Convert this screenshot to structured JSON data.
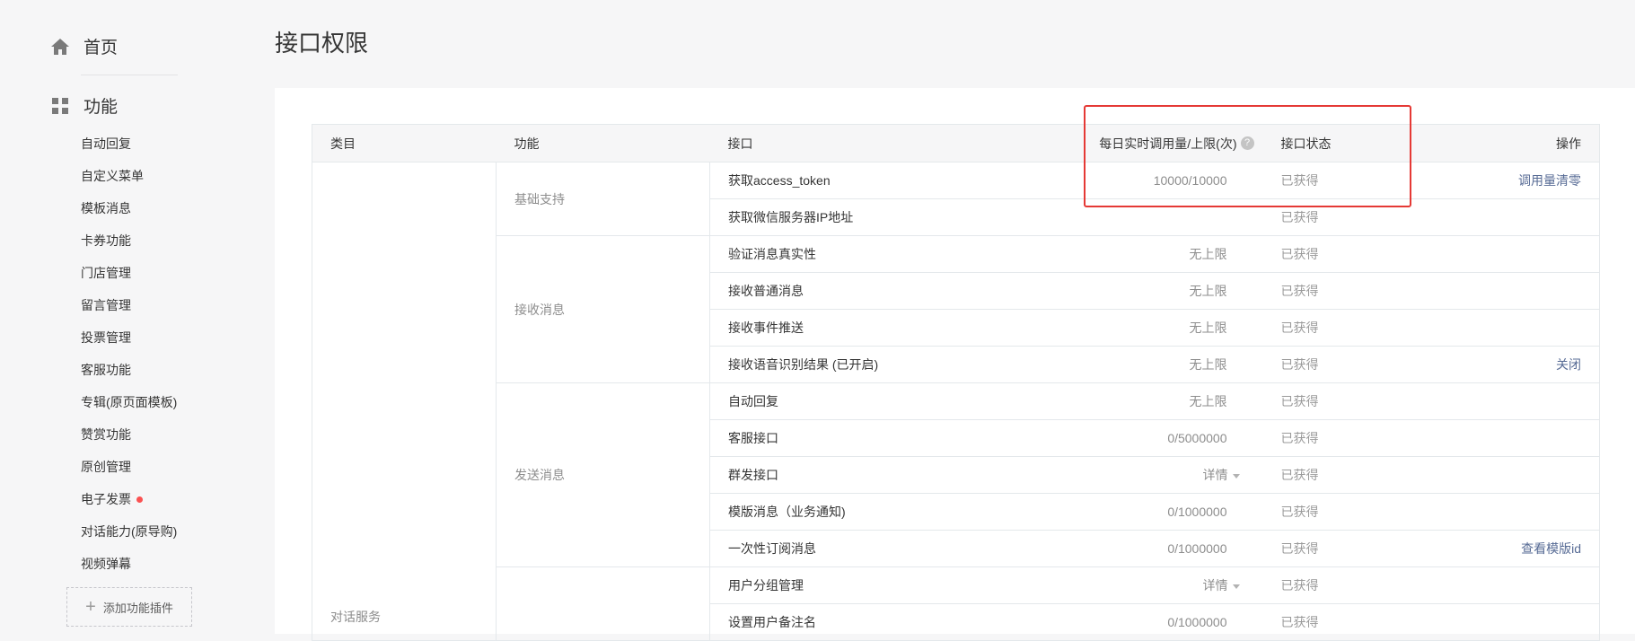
{
  "sidebar": {
    "home": {
      "label": "首页",
      "icon": "home-icon"
    },
    "features": {
      "label": "功能",
      "icon": "grid-icon"
    },
    "items": [
      {
        "label": "自动回复"
      },
      {
        "label": "自定义菜单"
      },
      {
        "label": "模板消息"
      },
      {
        "label": "卡券功能"
      },
      {
        "label": "门店管理"
      },
      {
        "label": "留言管理"
      },
      {
        "label": "投票管理"
      },
      {
        "label": "客服功能"
      },
      {
        "label": "专辑(原页面模板)"
      },
      {
        "label": "赞赏功能"
      },
      {
        "label": "原创管理"
      },
      {
        "label": "电子发票",
        "badge": "red-dot"
      },
      {
        "label": "对话能力(原导购)"
      },
      {
        "label": "视频弹幕"
      }
    ],
    "add_plugin_label": "添加功能插件"
  },
  "page": {
    "title": "接口权限"
  },
  "table": {
    "headers": {
      "category": "类目",
      "function": "功能",
      "api": "接口",
      "quota": "每日实时调用量/上限(次)",
      "help": "?",
      "status": "接口状态",
      "operation": "操作"
    },
    "category": "对话服务",
    "groups": {
      "basic": "基础支持",
      "receive": "接收消息",
      "send": "发送消息"
    },
    "rows": [
      {
        "api": "获取access_token",
        "quota": "10000/10000",
        "status": "已获得",
        "op": "调用量清零"
      },
      {
        "api": "获取微信服务器IP地址",
        "quota": "",
        "status": "已获得",
        "op": ""
      },
      {
        "api": "验证消息真实性",
        "quota": "无上限",
        "status": "已获得",
        "op": ""
      },
      {
        "api": "接收普通消息",
        "quota": "无上限",
        "status": "已获得",
        "op": ""
      },
      {
        "api": "接收事件推送",
        "quota": "无上限",
        "status": "已获得",
        "op": ""
      },
      {
        "api": "接收语音识别结果 (已开启)",
        "quota": "无上限",
        "status": "已获得",
        "op": "关闭"
      },
      {
        "api": "自动回复",
        "quota": "无上限",
        "status": "已获得",
        "op": ""
      },
      {
        "api": "客服接口",
        "quota": "0/5000000",
        "status": "已获得",
        "op": ""
      },
      {
        "api": "群发接口",
        "quota": "详情",
        "status": "已获得",
        "op": ""
      },
      {
        "api": "模版消息（业务通知)",
        "quota": "0/1000000",
        "status": "已获得",
        "op": ""
      },
      {
        "api": "一次性订阅消息",
        "quota": "0/1000000",
        "status": "已获得",
        "op": "查看模版id"
      },
      {
        "api": "用户分组管理",
        "quota": "详情",
        "status": "已获得",
        "op": ""
      },
      {
        "api": "设置用户备注名",
        "quota": "0/1000000",
        "status": "已获得",
        "op": ""
      }
    ]
  },
  "colors": {
    "link": "#576b95",
    "highlight": "#e53935",
    "badge": "#fa5151"
  }
}
